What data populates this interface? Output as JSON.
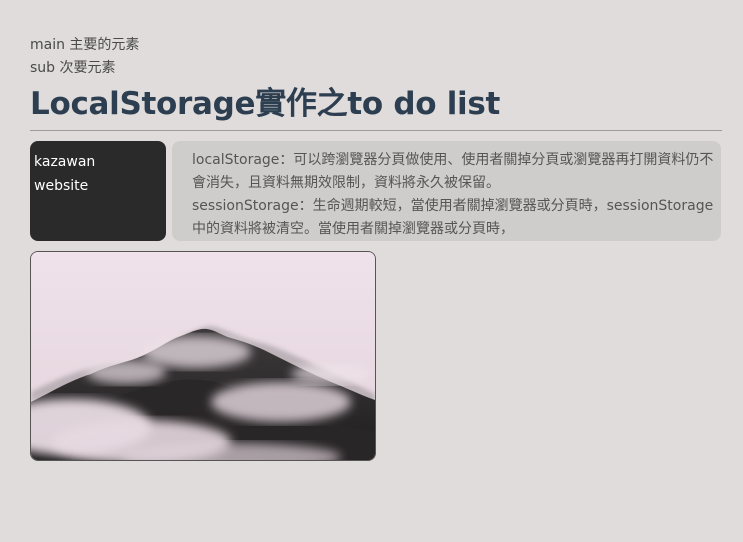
{
  "header": {
    "main_line": "main 主要的元素",
    "sub_line": "sub 次要元素",
    "title": "LocalStorage實作之to do list"
  },
  "sidebar": {
    "items": [
      {
        "label": "kazawan"
      },
      {
        "label": "website"
      }
    ]
  },
  "content": {
    "paragraphs": [
      "localStorage：可以跨瀏覽器分頁做使用、使用者關掉分頁或瀏覽器再打開資料仍不會消失，且資料無期效限制，資料將永久被保留。",
      "sessionStorage：生命週期較短，當使用者關掉瀏覽器或分頁時，sessionStorage 中的資料將被清空。當使用者關掉瀏覽器或分頁時，"
    ]
  },
  "image": {
    "subject": "misty-mountain-photo"
  },
  "colors": {
    "background": "#e0dcdb",
    "title": "#2c3e50",
    "sidebar_bg": "#2b2a2a",
    "content_bg": "#cfcdcc"
  }
}
